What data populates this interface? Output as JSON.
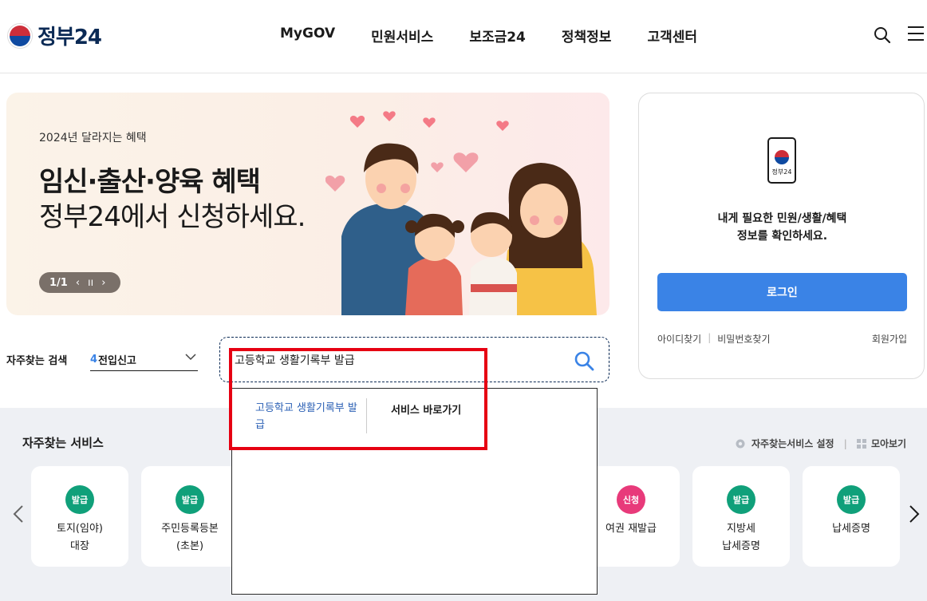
{
  "header": {
    "logo_text": "정부24",
    "nav": [
      "MyGOV",
      "민원서비스",
      "보조금24",
      "정책정보",
      "고객센터"
    ]
  },
  "banner": {
    "sub": "2024년 달라지는 혜택",
    "title": "임신·출산·양육 혜택",
    "subtitle": "정부24에서 신청하세요.",
    "pager": "1/1"
  },
  "login": {
    "phone_label": "정부24",
    "message_line1": "내게 필요한 민원/생활/혜택",
    "message_line2": "정보를 확인하세요.",
    "button": "로그인",
    "find_id": "아이디찾기",
    "find_pw": "비밀번호찾기",
    "join": "회원가입"
  },
  "frequent_search": {
    "label": "자주찾는 검색",
    "selected_num": "4",
    "selected_text": "전입신고"
  },
  "search": {
    "value": "고등학교 생활기록부 발급"
  },
  "autocomplete": {
    "item_line1": "고등학교 생활기록부 발",
    "item_line2": "급",
    "go_label": "서비스 바로가기"
  },
  "services": {
    "title": "자주찾는 서비스",
    "settings": "자주찾는서비스 설정",
    "view_all": "모아보기",
    "cards": [
      {
        "badge": "발급",
        "line1": "토지(임야)",
        "line2": "대장",
        "color": "green"
      },
      {
        "badge": "발급",
        "line1": "주민등록등본",
        "line2": "(초본)",
        "color": "green"
      },
      {
        "badge": "신청",
        "line1": "여권 재발급",
        "line2": "",
        "color": "pink"
      },
      {
        "badge": "발급",
        "line1": "지방세",
        "line2": "납세증명",
        "color": "green"
      },
      {
        "badge": "발급",
        "line1": "납세증명",
        "line2": "",
        "color": "green"
      }
    ]
  },
  "colors": {
    "primary": "#3a83e6",
    "navy": "#0b2a55",
    "highlight": "#e60012",
    "badge_green": "#10a07a",
    "badge_pink": "#e83a7a"
  }
}
